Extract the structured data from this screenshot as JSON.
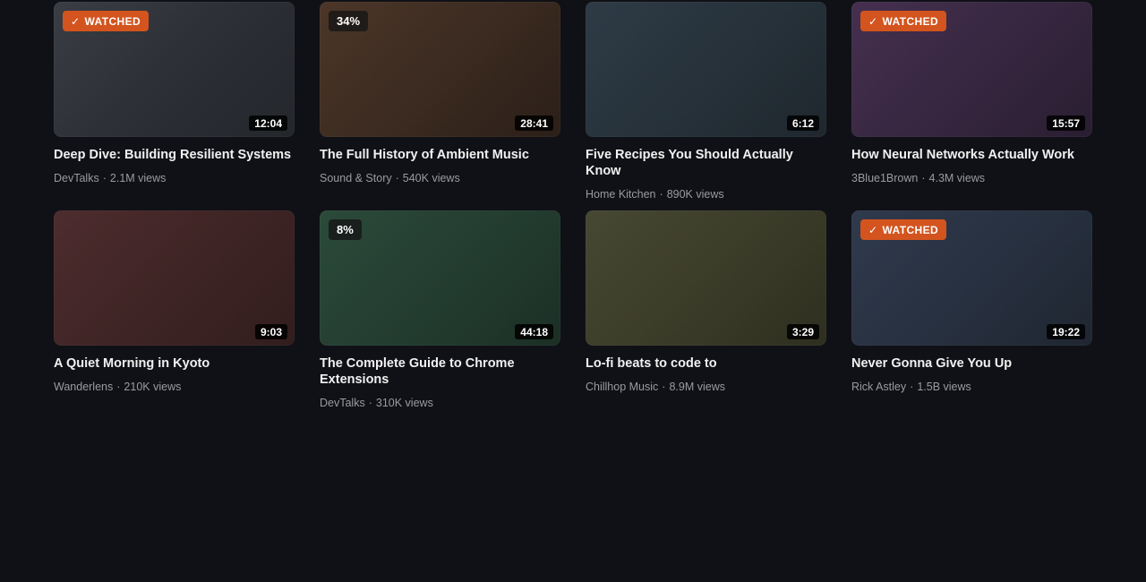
{
  "videos": [
    {
      "title": "Deep Dive: Building Resilient Systems",
      "channel": "DevTalks",
      "views": "2.1M views",
      "duration": "12:04",
      "badge": "WATCHED",
      "progress": "",
      "bg": "linear-gradient(135deg,#3a3d44 0%,#2b2e34 55%,#24272c 100%)"
    },
    {
      "title": "The Full History of Ambient Music",
      "channel": "Sound & Story",
      "views": "540K views",
      "duration": "28:41",
      "badge": "",
      "progress": "34%",
      "bg": "linear-gradient(135deg,#4b3628 0%,#3a2a20 55%,#2b1f18 100%)"
    },
    {
      "title": "Five Recipes You Should Actually Know",
      "channel": "Home Kitchen",
      "views": "890K views",
      "duration": "6:12",
      "badge": "",
      "progress": "",
      "bg": "linear-gradient(135deg,#2e3b46 0%,#263139 55%,#1f272e 100%)"
    },
    {
      "title": "How Neural Networks Actually Work",
      "channel": "3Blue1Brown",
      "views": "4.3M views",
      "duration": "15:57",
      "badge": "WATCHED",
      "progress": "",
      "bg": "linear-gradient(135deg,#45304f 0%,#36263f 55%,#2a1e31 100%)"
    },
    {
      "title": "A Quiet Morning in Kyoto",
      "channel": "Wanderlens",
      "views": "210K views",
      "duration": "9:03",
      "badge": "",
      "progress": "",
      "bg": "linear-gradient(135deg,#4d2c2e 0%,#3e2424 55%,#321d1c 100%)"
    },
    {
      "title": "The Complete Guide to Chrome Extensions",
      "channel": "DevTalks",
      "views": "310K views",
      "duration": "44:18",
      "badge": "",
      "progress": "8%",
      "bg": "linear-gradient(135deg,#2b4a3a 0%,#233c30 55%,#1b2f25 100%)"
    },
    {
      "title": "Lo-fi beats to code to",
      "channel": "Chillhop Music",
      "views": "8.9M views",
      "duration": "3:29",
      "badge": "",
      "progress": "",
      "bg": "linear-gradient(135deg,#474833 0%,#3a3b28 55%,#2e2f1f 100%)"
    },
    {
      "title": "Never Gonna Give You Up",
      "channel": "Rick Astley",
      "views": "1.5B views",
      "duration": "19:22",
      "badge": "WATCHED",
      "progress": "",
      "bg": "linear-gradient(135deg,#2f3a4d 0%,#27303f 55%,#1f2631 100%)"
    }
  ],
  "separator": "·",
  "icons": {
    "watched": "check-icon"
  },
  "colors": {
    "watched_badge": "#d3541e",
    "background": "#101116",
    "meta_text": "#9a9ba0"
  }
}
